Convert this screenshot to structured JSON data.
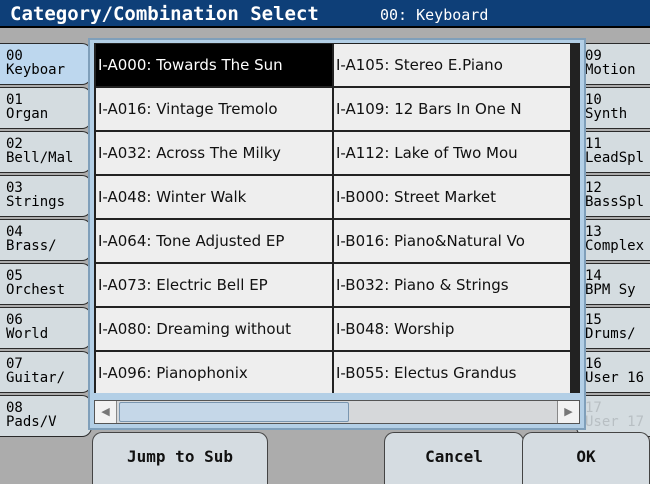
{
  "header": {
    "title": "Category/Combination Select",
    "subtitle": "00: Keyboard"
  },
  "left_tabs": [
    {
      "number": "00",
      "name": "Keyboar",
      "active": true
    },
    {
      "number": "01",
      "name": "Organ"
    },
    {
      "number": "02",
      "name": "Bell/Mal"
    },
    {
      "number": "03",
      "name": "Strings"
    },
    {
      "number": "04",
      "name": "Brass/"
    },
    {
      "number": "05",
      "name": "Orchest"
    },
    {
      "number": "06",
      "name": "World"
    },
    {
      "number": "07",
      "name": "Guitar/"
    },
    {
      "number": "08",
      "name": "Pads/V"
    }
  ],
  "right_tabs": [
    {
      "number": "09",
      "name": "Motion"
    },
    {
      "number": "10",
      "name": "Synth"
    },
    {
      "number": "11",
      "name": "LeadSpl"
    },
    {
      "number": "12",
      "name": "BassSpl"
    },
    {
      "number": "13",
      "name": "Complex"
    },
    {
      "number": "14",
      "name": "BPM Sy"
    },
    {
      "number": "15",
      "name": "Drums/"
    },
    {
      "number": "16",
      "name": "User 16"
    },
    {
      "number": "17",
      "name": "User 17",
      "disabled": true
    }
  ],
  "combinations": {
    "column_1": [
      "I-A000: Towards The Sun",
      "I-A016: Vintage Tremolo",
      "I-A032: Across The Milky",
      "I-A048: Winter Walk",
      "I-A064: Tone Adjusted EP",
      "I-A073: Electric Bell EP",
      "I-A080: Dreaming without",
      "I-A096: Pianophonix"
    ],
    "column_2": [
      "I-A105: Stereo E.Piano",
      "I-A109: 12 Bars In One N",
      "I-A112: Lake of Two Mou",
      "I-B000: Street Market",
      "I-B016: Piano&Natural Vo",
      "I-B032: Piano & Strings",
      "I-B048: Worship",
      "I-B055: Electus Grandus"
    ],
    "selected": "I-A000: Towards The Sun"
  },
  "scrollbar": {
    "left_icon": "scroll-left-arrow-icon",
    "right_icon": "scroll-right-arrow-icon"
  },
  "buttons": {
    "jump_to_sub": "Jump to Sub",
    "cancel": "Cancel",
    "ok": "OK"
  },
  "colors": {
    "title_bar": "#0e3f78",
    "selected_row": "#000000",
    "active_tab": "#bdd7ee",
    "list_frame": "#b3cfe6"
  }
}
